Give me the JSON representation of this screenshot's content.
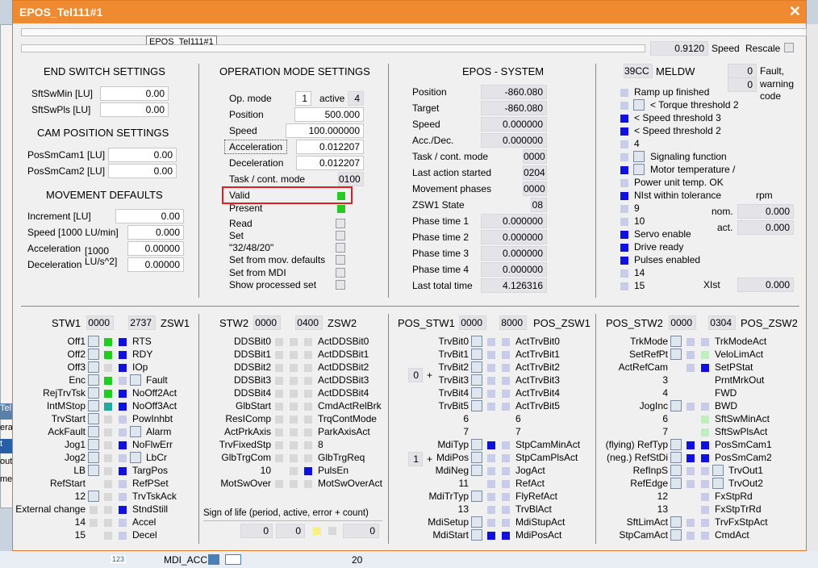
{
  "window": {
    "title": "EPOS_Tel111#1",
    "close": "✕",
    "tooltip": "EPOS_Tel111#1"
  },
  "bg": {
    "tab": "Tel",
    "items": [
      "eral",
      "t",
      "out",
      "me"
    ],
    "bottom_badge": "123",
    "bottom_label": "MDI_ACC",
    "bottom_value": "20"
  },
  "top": {
    "speed_value": "0.9120",
    "speed_label": "Speed",
    "rescale_label": "Rescale"
  },
  "end_switch": {
    "title": "END SWITCH SETTINGS",
    "rows": [
      {
        "label": "SftSwMin [LU]",
        "value": "0.00"
      },
      {
        "label": "SftSwPls [LU]",
        "value": "0.00"
      }
    ]
  },
  "cam_pos": {
    "title": "CAM POSITION SETTINGS",
    "rows": [
      {
        "label": "PosSmCam1 [LU]",
        "value": "0.00"
      },
      {
        "label": "PosSmCam2 [LU]",
        "value": "0.00"
      }
    ]
  },
  "movement": {
    "title": "MOVEMENT DEFAULTS",
    "rows": [
      {
        "label": "Increment [LU]",
        "value": "0.00"
      },
      {
        "label": "Speed [1000 LU/min]",
        "value": "0.000"
      },
      {
        "label": "Acceleration",
        "value": "0.00000"
      },
      {
        "label": "Deceleration",
        "value": "0.00000"
      }
    ],
    "unit1": "[1000",
    "unit2": "LU/s^2]"
  },
  "opmode": {
    "title": "OPERATION MODE SETTINGS",
    "op_label": "Op. mode",
    "op_value": "1",
    "active_label": "active",
    "active_value": "4",
    "rows": [
      {
        "label": "Position",
        "value": "500.000"
      },
      {
        "label": "Speed",
        "value": "100.000000"
      },
      {
        "label": "Acceleration",
        "value": "0.012207"
      },
      {
        "label": "Deceleration",
        "value": "0.012207"
      },
      {
        "label": "Task / cont. mode",
        "value": "0100"
      }
    ],
    "valid": "Valid",
    "present": "Present",
    "checks": [
      "Read",
      "Set",
      "\"32/48/20\"",
      "Set from mov. defaults",
      "Set from MDI",
      "Show processed set"
    ]
  },
  "epos": {
    "title": "EPOS - SYSTEM",
    "rows": [
      {
        "label": "Position",
        "value": "-860.080"
      },
      {
        "label": "Target",
        "value": "-860.080"
      },
      {
        "label": "Speed",
        "value": "0.000000"
      },
      {
        "label": "Acc./Dec.",
        "value": "0.000000"
      },
      {
        "label": "Task / cont. mode",
        "value": "0000"
      },
      {
        "label": "Last action started",
        "value": "0204"
      },
      {
        "label": "Movement phases",
        "value": "0000"
      },
      {
        "label": "ZSW1 State",
        "value": "08"
      },
      {
        "label": "Phase time 1",
        "value": "0.000000"
      },
      {
        "label": "Phase time 2",
        "value": "0.000000"
      },
      {
        "label": "Phase time 3",
        "value": "0.000000"
      },
      {
        "label": "Phase time 4",
        "value": "0.000000"
      },
      {
        "label": "Last total time",
        "value": "4.126316"
      }
    ]
  },
  "meldw": {
    "code": "39CC",
    "title": "MELDW",
    "fault_value": "0",
    "warn_value": "0",
    "fault_label": "Fault,",
    "warn_label": "warning",
    "code_label": "code",
    "items": [
      "Ramp up finished",
      "< Torque threshold 2",
      "< Speed threshold 3",
      "< Speed threshold 2",
      "4",
      "Signaling function",
      "Motor temperature /",
      "Power unit temp. OK",
      "NIst within tolerance",
      "9",
      "10",
      "Servo enable",
      "Drive ready",
      "Pulses enabled",
      "14",
      "15"
    ],
    "rpm": "rpm",
    "nom_label": "nom.",
    "nom_value": "0.000",
    "act_label": "act.",
    "act_value": "0.000",
    "xist_label": "XIst",
    "xist_value": "0.000"
  },
  "stw1": {
    "title": "STW1",
    "val": "0000",
    "zval": "2737",
    "ztitle": "ZSW1",
    "left": [
      "Off1",
      "Off2",
      "Off3",
      "Enc",
      "RejTrvTsk",
      "IntMStop",
      "TrvStart",
      "AckFault",
      "Jog1",
      "Jog2",
      "LB",
      "RefStart",
      "12",
      "External change",
      "14",
      "15"
    ],
    "right": [
      "RTS",
      "RDY",
      "IOp",
      "Fault",
      "NoOff2Act",
      "NoOff3Act",
      "PowInhbt",
      "Alarm",
      "NoFlwErr",
      "LbCr",
      "TargPos",
      "RefPSet",
      "TrvTskAck",
      "StndStill",
      "Accel",
      "Decel"
    ]
  },
  "stw2": {
    "title": "STW2",
    "val": "0000",
    "zval": "0400",
    "ztitle": "ZSW2",
    "left": [
      "DDSBit0",
      "DDSBit1",
      "DDSBit2",
      "DDSBit3",
      "DDSBit4",
      "GlbStart",
      "ResIComp",
      "ActPrkAxis",
      "TrvFixedStp",
      "GlbTrgCom",
      "10",
      "MotSwOver"
    ],
    "right": [
      "ActDDSBit0",
      "ActDDSBit1",
      "ActDDSBit2",
      "ActDDSBit3",
      "ActDDSBit4",
      "CmdActRelBrk",
      "TrqContMode",
      "ParkAxisAct",
      "8",
      "GlbTrgReq",
      "PulsEn",
      "MotSwOverAct"
    ],
    "sol_title": "Sign of life (period, active, error + count)",
    "sol_a": "0",
    "sol_b": "0",
    "sol_c": "0"
  },
  "posstw1": {
    "title": "POS_STW1",
    "val": "0000",
    "zval": "8000",
    "ztitle": "POS_ZSW1",
    "left": [
      "TrvBit0",
      "TrvBit1",
      "TrvBit2",
      "TrvBit3",
      "TrvBit4",
      "TrvBit5",
      "6",
      "7",
      "MdiTyp",
      "MdiPos",
      "MdiNeg",
      "11",
      "MdiTrTyp",
      "13",
      "MdiSetup",
      "MdiStart"
    ],
    "right": [
      "ActTrvBit0",
      "ActTrvBit1",
      "ActTrvBit2",
      "ActTrvBit3",
      "ActTrvBit4",
      "ActTrvBit5",
      "6",
      "7",
      "StpCamMinAct",
      "StpCamPlsAct",
      "JogAct",
      "RefAct",
      "FlyRefAct",
      "TrvBlAct",
      "MdiStupAct",
      "MdiPosAct"
    ],
    "sel1": "0",
    "sel2": "1",
    "plus": "+"
  },
  "posstw2": {
    "title": "POS_STW2",
    "val": "0000",
    "zval": "0304",
    "ztitle": "POS_ZSW2",
    "left": [
      "TrkMode",
      "SetRefPt",
      "ActRefCam",
      "3",
      "4",
      "JogInc",
      "6",
      "7",
      "(flying) RefTyp",
      "(neg.) RefStDi",
      "RefInpS",
      "RefEdge",
      "12",
      "13",
      "SftLimAct",
      "StpCamAct"
    ],
    "right": [
      "TrkModeAct",
      "VeloLimAct",
      "SetPStat",
      "PrntMrkOut",
      "FWD",
      "BWD",
      "SftSwMinAct",
      "SftSwPlsAct",
      "PosSmCam1",
      "PosSmCam2",
      "TrvOut1",
      "TrvOut2",
      "FxStpRd",
      "FxStpTrRd",
      "TrvFxStpAct",
      "CmdAct"
    ]
  }
}
